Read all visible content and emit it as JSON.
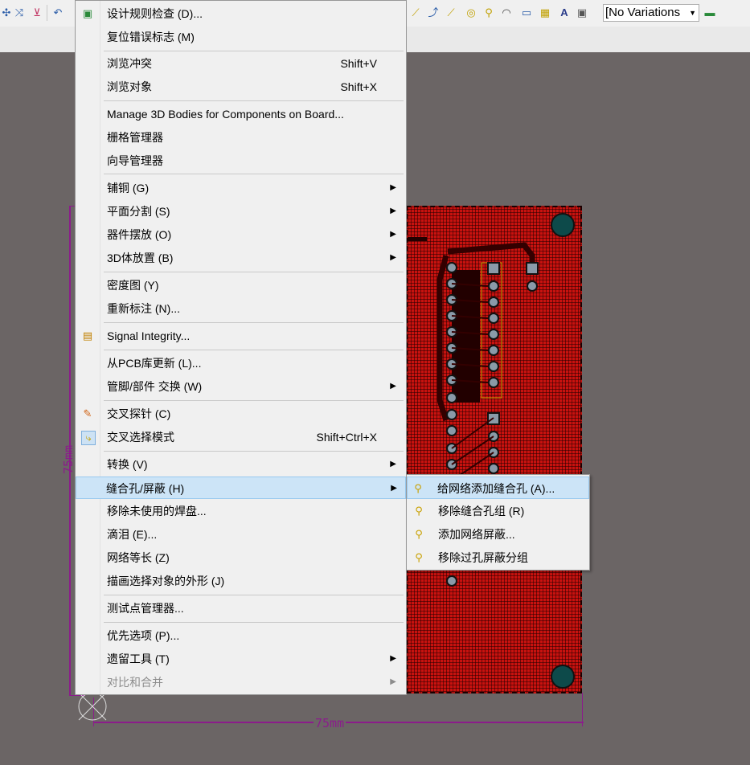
{
  "toolbar": {
    "variations_label": "[No Variations"
  },
  "board": {
    "dim_vertical": "75mm",
    "dim_horizontal": "75mm"
  },
  "menu": {
    "items": [
      {
        "label": "设计规则检查 (D)...",
        "icon": "drc-icon"
      },
      {
        "label": "复位错误标志 (M)"
      },
      {
        "label": "浏览冲突",
        "shortcut": "Shift+V"
      },
      {
        "label": "浏览对象",
        "shortcut": "Shift+X"
      },
      {
        "label": "Manage 3D Bodies for Components on Board..."
      },
      {
        "label": "栅格管理器"
      },
      {
        "label": "向导管理器"
      },
      {
        "label": "铺铜 (G)",
        "submenu": true
      },
      {
        "label": "平面分割 (S)",
        "submenu": true
      },
      {
        "label": "器件摆放 (O)",
        "submenu": true
      },
      {
        "label": "3D体放置 (B)",
        "submenu": true
      },
      {
        "label": "密度图 (Y)"
      },
      {
        "label": "重新标注 (N)..."
      },
      {
        "label": "Signal Integrity...",
        "icon": "signal-integrity-icon"
      },
      {
        "label": "从PCB库更新 (L)..."
      },
      {
        "label": "管脚/部件 交换 (W)",
        "submenu": true
      },
      {
        "label": "交叉探针 (C)",
        "icon": "cross-probe-icon"
      },
      {
        "label": "交叉选择模式",
        "shortcut": "Shift+Ctrl+X",
        "icon": "cross-select-icon"
      },
      {
        "label": "转换 (V)",
        "submenu": true
      },
      {
        "label": "缝合孔/屏蔽 (H)",
        "submenu": true,
        "highlighted": true
      },
      {
        "label": "移除未使用的焊盘..."
      },
      {
        "label": "滴泪 (E)..."
      },
      {
        "label": "网络等长 (Z)"
      },
      {
        "label": "描画选择对象的外形 (J)"
      },
      {
        "label": "测试点管理器..."
      },
      {
        "label": "优先选项 (P)..."
      },
      {
        "label": "遗留工具 (T)",
        "submenu": true
      },
      {
        "label": "对比和合并",
        "submenu": true,
        "disabled": true
      }
    ]
  },
  "submenu": {
    "items": [
      {
        "label": "给网络添加缝合孔 (A)...",
        "highlighted": true
      },
      {
        "label": "移除缝合孔组 (R)"
      },
      {
        "label": "添加网络屏蔽..."
      },
      {
        "label": "移除过孔屏蔽分组"
      }
    ]
  },
  "colors": {
    "board": "#c8120f",
    "dimension": "#8b1c8b",
    "highlight": "#cce4f7"
  }
}
